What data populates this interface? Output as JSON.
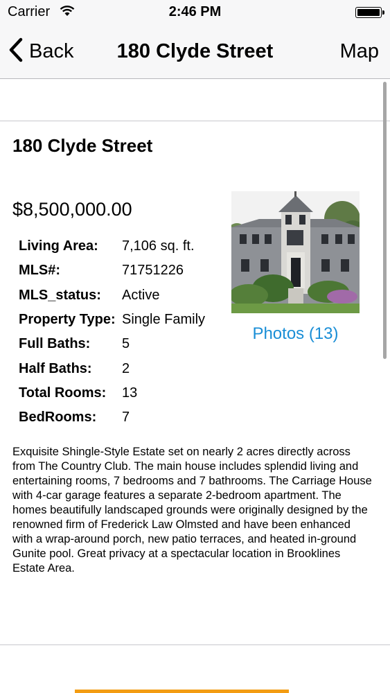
{
  "status_bar": {
    "carrier": "Carrier",
    "time": "2:46 PM"
  },
  "nav": {
    "back_label": "Back",
    "title": "180 Clyde Street",
    "map_label": "Map"
  },
  "listing": {
    "title": "180 Clyde Street",
    "price": "$8,500,000.00",
    "details": [
      {
        "label": "Living Area:",
        "value": "7,106 sq. ft."
      },
      {
        "label": "MLS#:",
        "value": "71751226"
      },
      {
        "label": "MLS_status:",
        "value": "Active"
      },
      {
        "label": "Property Type:",
        "value": "Single Family"
      },
      {
        "label": "Full Baths:",
        "value": "5"
      },
      {
        "label": "Half Baths:",
        "value": "2"
      },
      {
        "label": "Total Rooms:",
        "value": "13"
      },
      {
        "label": "BedRooms:",
        "value": "7"
      }
    ],
    "photos_link": "Photos (13)",
    "description": "Exquisite Shingle-Style Estate set on nearly 2 acres directly across from The Country Club.  The main house includes splendid living and entertaining rooms, 7 bedrooms and 7 bathrooms.  The Carriage House with 4-car garage features a separate 2-bedroom apartment.  The homes beautifully landscaped grounds were originally designed by the renowned firm of Frederick Law Olmsted and have been enhanced with a wrap-around porch, new patio terraces, and heated in-ground Gunite pool.  Great privacy at a spectacular location in Brooklines Estate Area."
  },
  "colors": {
    "link": "#1a8ed6",
    "accent": "#f39c12"
  },
  "icons": [
    "wifi-icon",
    "battery-icon",
    "back-chevron-icon"
  ]
}
